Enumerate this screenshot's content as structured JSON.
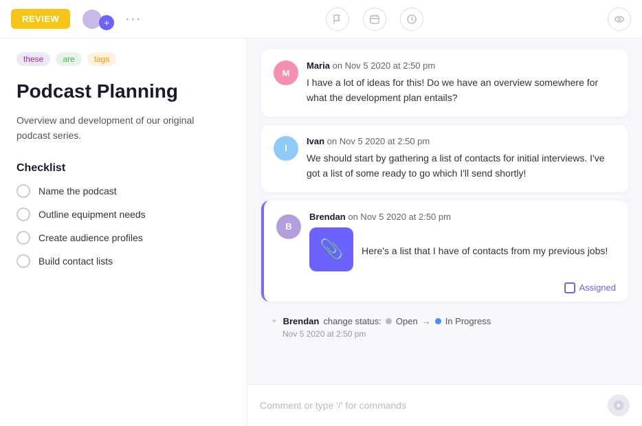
{
  "topbar": {
    "review_label": "REVIEW",
    "more_label": "···",
    "icons": {
      "flag": "⚑",
      "calendar": "▭",
      "clock": "◷",
      "eye": "◉"
    }
  },
  "left": {
    "tags": [
      {
        "label": "these",
        "style": "tag-purple"
      },
      {
        "label": "are",
        "style": "tag-green"
      },
      {
        "label": "tags",
        "style": "tag-orange"
      }
    ],
    "title": "Podcast Planning",
    "description": "Overview and development of our original podcast series.",
    "checklist_title": "Checklist",
    "checklist_items": [
      {
        "label": "Name the podcast"
      },
      {
        "label": "Outline equipment needs"
      },
      {
        "label": "Create audience profiles"
      },
      {
        "label": "Build contact lists"
      }
    ]
  },
  "comments": [
    {
      "author": "Maria",
      "timestamp": "on Nov 5 2020 at 2:50 pm",
      "text": "I have a lot of ideas for this! Do we have an overview somewhere for what the development plan entails?",
      "avatar_letter": "M",
      "avatar_class": "avatar-pink"
    },
    {
      "author": "Ivan",
      "timestamp": "on Nov 5 2020 at 2:50 pm",
      "text": "We should start by gathering a list of contacts for initial interviews. I've got a list of some ready to go which I'll send shortly!",
      "avatar_letter": "I",
      "avatar_class": "avatar-blue"
    }
  ],
  "brendan_comment": {
    "author": "Brendan",
    "timestamp": "on Nov 5 2020 at 2:50 pm",
    "text": "Here's a list that I have of contacts from my previous jobs!",
    "avatar_letter": "B",
    "avatar_class": "avatar-purple",
    "assigned_label": "Assigned"
  },
  "status_change": {
    "author": "Brendan",
    "action": "change status:",
    "from": "Open",
    "to": "In Progress",
    "date": "Nov 5 2020 at 2:50 pm"
  },
  "comment_input": {
    "placeholder": "Comment or type '/' for commands"
  }
}
